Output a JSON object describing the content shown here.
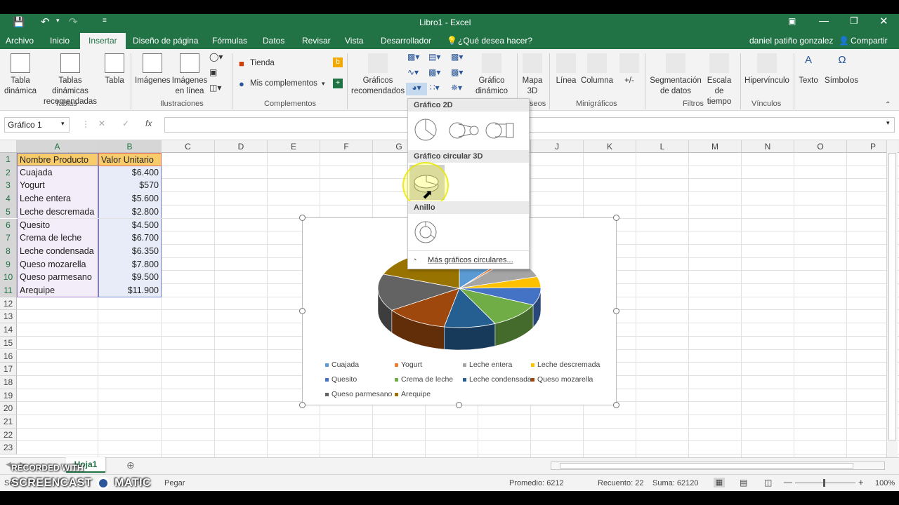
{
  "window": {
    "title": "Libro1 - Excel"
  },
  "tabs": [
    "Archivo",
    "Inicio",
    "Insertar",
    "Diseño de página",
    "Fórmulas",
    "Datos",
    "Revisar",
    "Vista",
    "Desarrollador"
  ],
  "tell_me": "¿Qué desea hacer?",
  "user": "daniel patiño gonzalez",
  "share": "Compartir",
  "ribbon": {
    "tabla_dinamica": "Tabla dinámica",
    "tablas_recomendadas": "Tablas dinámicas recomendadas",
    "tabla": "Tabla",
    "imagenes": "Imágenes",
    "imagenes_linea": "Imágenes en línea",
    "tienda": "Tienda",
    "mis_complementos": "Mis complementos",
    "graficos_recomendados": "Gráficos recomendados",
    "grafico_dinamico": "Gráfico dinámico",
    "mapa_3d": "Mapa 3D",
    "linea": "Línea",
    "columna": "Columna",
    "ganancia": "+/-",
    "segmentacion": "Segmentación de datos",
    "escala_tiempo": "Escala de tiempo",
    "hipervinculo": "Hipervínculo",
    "texto": "Texto",
    "simbolos": "Símbolos",
    "groups": {
      "tablas": "Tablas",
      "ilustraciones": "Ilustraciones",
      "complementos": "Complementos",
      "paseos": "seos",
      "minigraficos": "Minigráficos",
      "filtros": "Filtros",
      "vinculos": "Vínculos"
    }
  },
  "formula_bar": {
    "name_box": "Gráfico 1",
    "fx": "fx"
  },
  "columns": [
    "A",
    "B",
    "C",
    "D",
    "E",
    "F",
    "G",
    "H",
    "I",
    "J",
    "K",
    "L",
    "M",
    "N",
    "O",
    "P"
  ],
  "rows": [
    "1",
    "2",
    "3",
    "4",
    "5",
    "6",
    "7",
    "8",
    "9",
    "10",
    "11",
    "12",
    "13",
    "14",
    "15",
    "16",
    "17",
    "18",
    "19",
    "20",
    "21",
    "22",
    "23"
  ],
  "table": {
    "headers": [
      "Nombre Producto",
      "Valor Unitario"
    ],
    "rows": [
      [
        "Cuajada",
        "$6.400"
      ],
      [
        "Yogurt",
        "$570"
      ],
      [
        "Leche entera",
        "$5.600"
      ],
      [
        "Leche descremada",
        "$2.800"
      ],
      [
        "Quesito",
        "$4.500"
      ],
      [
        "Crema de leche",
        "$6.700"
      ],
      [
        "Leche condensada",
        "$6.350"
      ],
      [
        "Queso mozarella",
        "$7.800"
      ],
      [
        "Queso parmesano",
        "$9.500"
      ],
      [
        "Arequipe",
        "$11.900"
      ]
    ]
  },
  "chart_data": {
    "type": "pie",
    "categories": [
      "Cuajada",
      "Yogurt",
      "Leche entera",
      "Leche descremada",
      "Quesito",
      "Crema de leche",
      "Leche condensada",
      "Queso mozarella",
      "Queso parmesano",
      "Arequipe"
    ],
    "values": [
      6400,
      570,
      5600,
      2800,
      4500,
      6700,
      6350,
      7800,
      9500,
      11900
    ],
    "colors": [
      "#5b9bd5",
      "#ed7d31",
      "#a5a5a5",
      "#ffc000",
      "#4472c4",
      "#70ad47",
      "#255e91",
      "#9e480e",
      "#636363",
      "#997300"
    ],
    "legend_position": "bottom",
    "style": "3d"
  },
  "dropdown": {
    "section_2d": "Gráfico 2D",
    "section_3d": "Gráfico circular 3D",
    "section_donut": "Anillo",
    "more": "Más gráficos circulares..."
  },
  "sheet_tab": "Hoja1",
  "status": {
    "left": "Se",
    "pegar": "Pegar",
    "promedio": "Promedio: 6212",
    "recuento": "Recuento: 22",
    "suma": "Suma: 62120",
    "zoom": "100%"
  },
  "watermark": {
    "line1": "RECORDED WITH",
    "line2": "SCREENCAST",
    "line3": "MATIC"
  }
}
